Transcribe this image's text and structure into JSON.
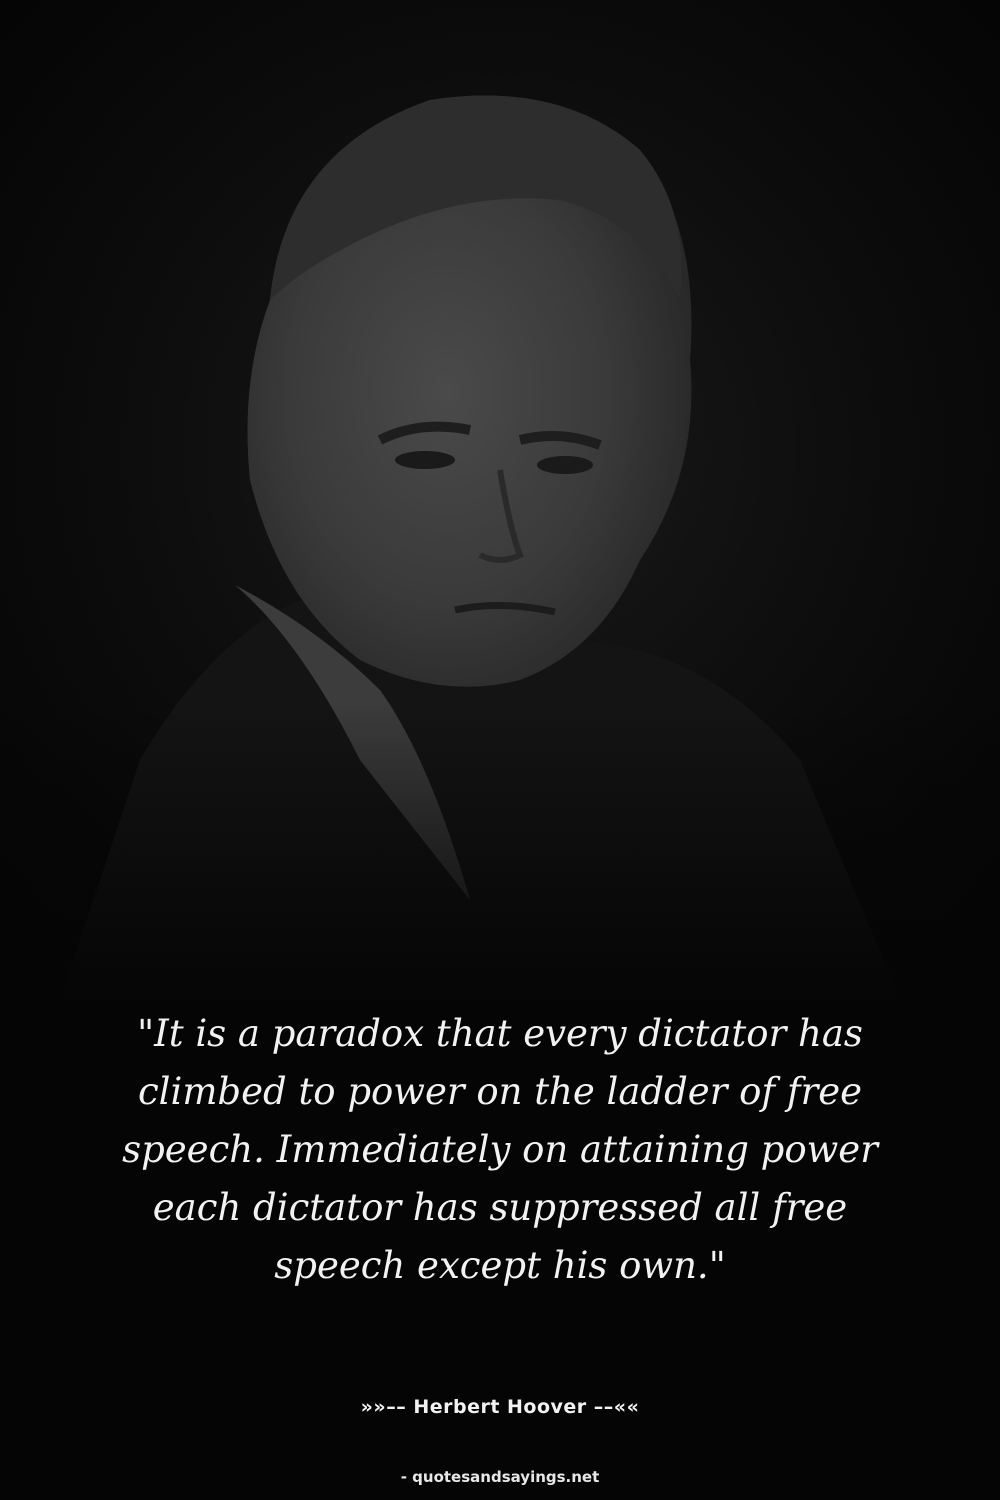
{
  "quote": {
    "text": "\"It is a paradox that every dictator has climbed to power on the ladder of free speech. Immediately on attaining power each dictator has suppressed all free speech except his own.\""
  },
  "author": {
    "line": "»»–– Herbert Hoover ––««"
  },
  "source": {
    "site": "- quotesandsayings.net"
  }
}
